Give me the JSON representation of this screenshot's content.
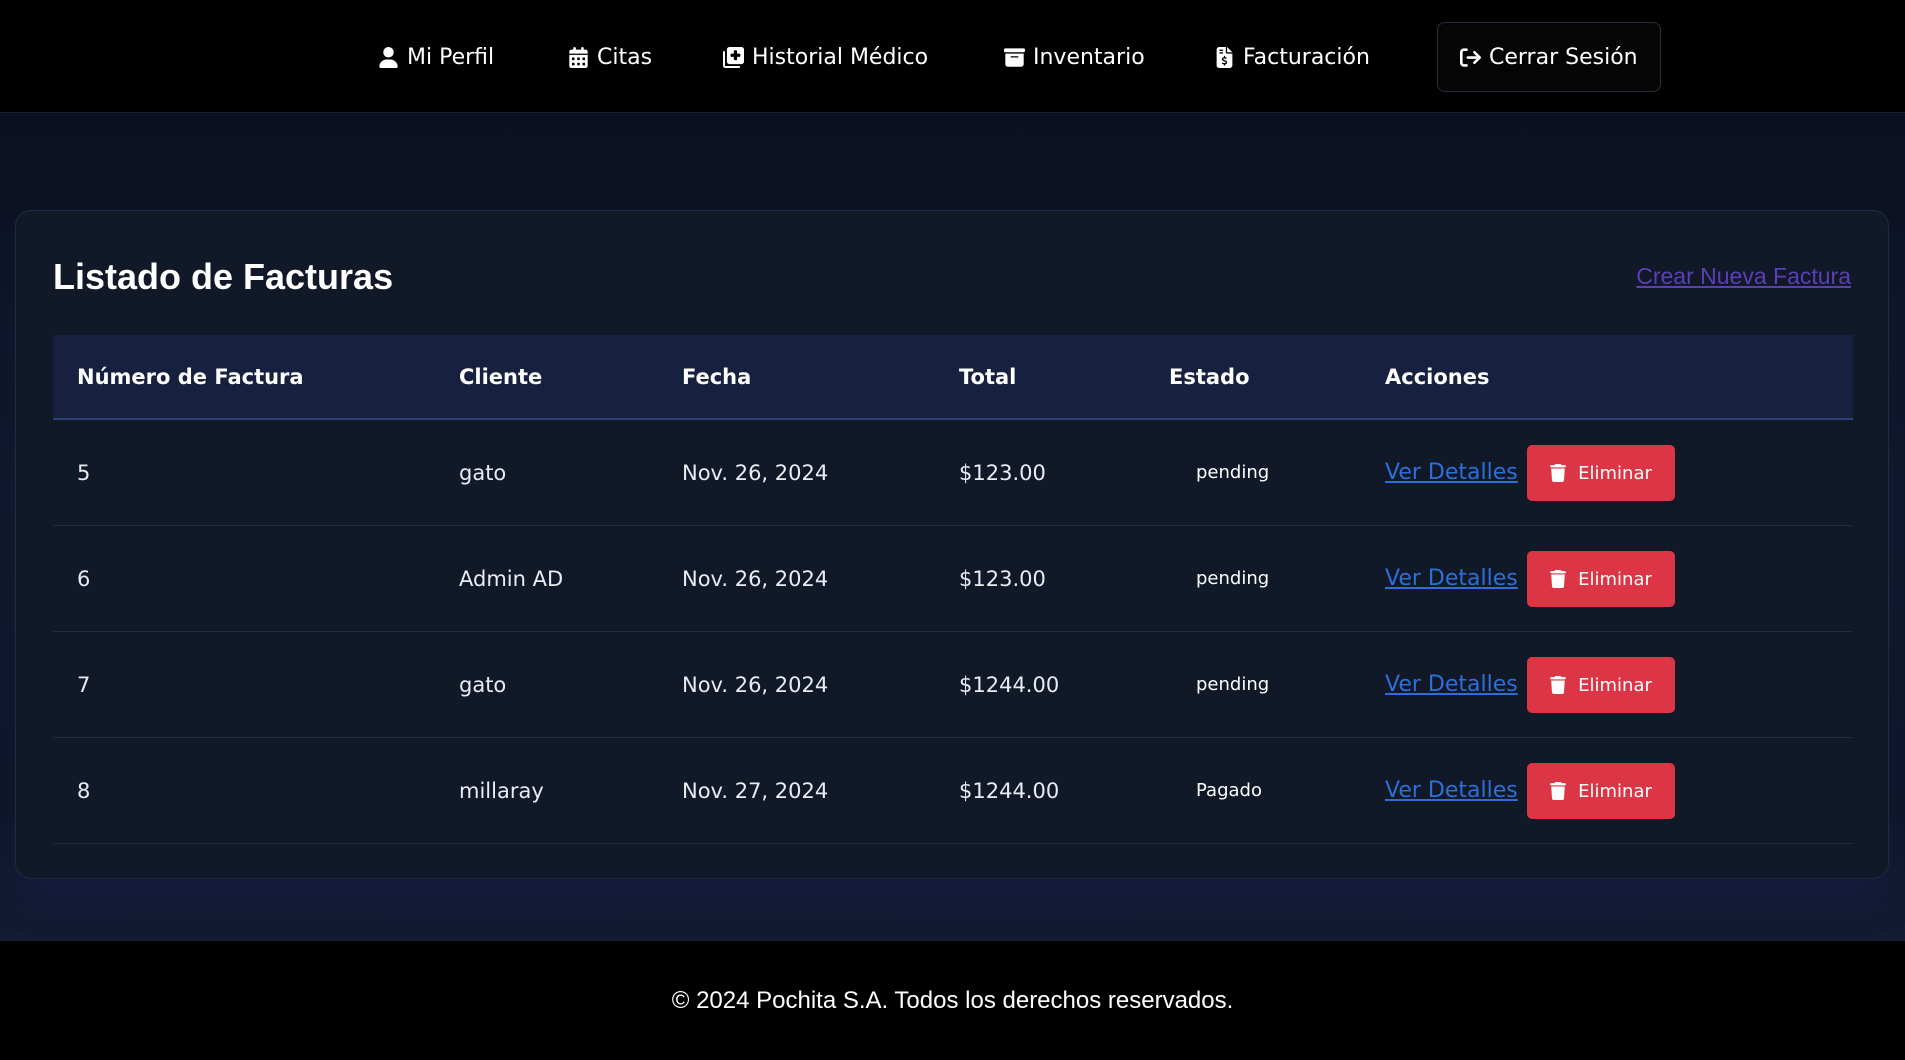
{
  "nav": {
    "items": [
      {
        "label": "Mi Perfil",
        "icon": "user-icon"
      },
      {
        "label": "Citas",
        "icon": "calendar-icon"
      },
      {
        "label": "Historial Médico",
        "icon": "medical-plus-icon"
      },
      {
        "label": "Inventario",
        "icon": "box-icon"
      },
      {
        "label": "Facturación",
        "icon": "invoice-dollar-icon"
      }
    ],
    "logout": {
      "label": "Cerrar Sesión",
      "icon": "sign-out-icon"
    }
  },
  "page": {
    "title": "Listado de Facturas",
    "create_link": "Crear Nueva Factura"
  },
  "table": {
    "headers": [
      "Número de Factura",
      "Cliente",
      "Fecha",
      "Total",
      "Estado",
      "Acciones"
    ],
    "rows": [
      {
        "numero": "5",
        "cliente": "gato",
        "fecha": "Nov. 26, 2024",
        "total": "$123.00",
        "estado": "pending",
        "details": "Ver Detalles",
        "delete": "Eliminar"
      },
      {
        "numero": "6",
        "cliente": "Admin AD",
        "fecha": "Nov. 26, 2024",
        "total": "$123.00",
        "estado": "pending",
        "details": "Ver Detalles",
        "delete": "Eliminar"
      },
      {
        "numero": "7",
        "cliente": "gato",
        "fecha": "Nov. 26, 2024",
        "total": "$1244.00",
        "estado": "pending",
        "details": "Ver Detalles",
        "delete": "Eliminar"
      },
      {
        "numero": "8",
        "cliente": "millaray",
        "fecha": "Nov. 27, 2024",
        "total": "$1244.00",
        "estado": "Pagado",
        "details": "Ver Detalles",
        "delete": "Eliminar"
      }
    ]
  },
  "footer": {
    "text": "© 2024 Pochita S.A. Todos los derechos reservados."
  },
  "colors": {
    "danger": "#dc3545",
    "link": "#2d6fd8",
    "create_link": "#5b3fb5",
    "header_bg": "#17213f",
    "card_bg": "#111827"
  }
}
